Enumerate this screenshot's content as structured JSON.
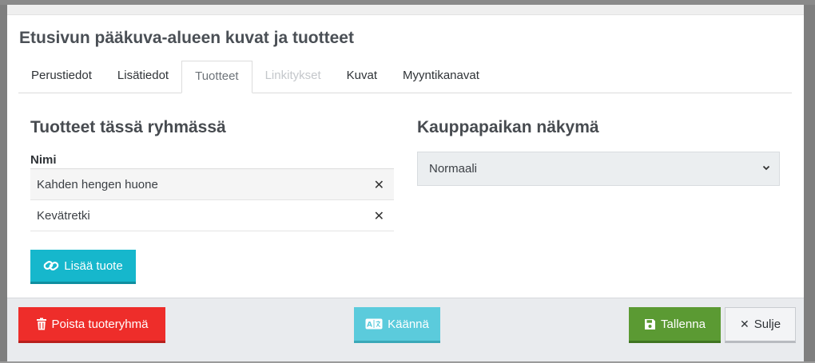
{
  "dialog": {
    "title": "Etusivun pääkuva-alueen kuvat ja tuotteet"
  },
  "tabs": [
    {
      "label": "Perustiedot",
      "state": "normal"
    },
    {
      "label": "Lisätiedot",
      "state": "normal"
    },
    {
      "label": "Tuotteet",
      "state": "active"
    },
    {
      "label": "Linkitykset",
      "state": "disabled"
    },
    {
      "label": "Kuvat",
      "state": "normal"
    },
    {
      "label": "Myyntikanavat",
      "state": "normal"
    }
  ],
  "products_section": {
    "title": "Tuotteet tässä ryhmässä",
    "column_header": "Nimi",
    "rows": [
      {
        "name": "Kahden hengen huone",
        "remove_icon": "close-icon"
      },
      {
        "name": "Kevätretki",
        "remove_icon": "close-icon"
      }
    ],
    "add_button": {
      "label": "Lisää tuote",
      "icon": "link-icon"
    }
  },
  "marketplace_section": {
    "title": "Kauppapaikan näkymä",
    "selected_view": "Normaali",
    "select_icon": "chevron-down-icon"
  },
  "footer": {
    "delete_button": {
      "label": "Poista tuoteryhmä",
      "icon": "trash-icon"
    },
    "translate_button": {
      "label": "Käännä",
      "icon": "translate-icon"
    },
    "save_button": {
      "label": "Tallenna",
      "icon": "floppy-disk-icon"
    },
    "close_button": {
      "label": "Sulje",
      "icon": "close-icon"
    }
  },
  "colors": {
    "add_button": "#16b7cc",
    "delete_button": "#ee2d2a",
    "translate_button": "#5bcbdc",
    "save_button": "#5b9a33",
    "close_button": "#f3f4f6",
    "footer_background": "#e9ebee",
    "select_background": "#ebeef0"
  }
}
